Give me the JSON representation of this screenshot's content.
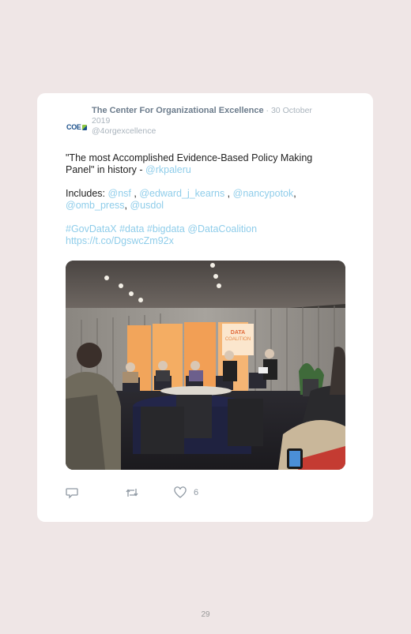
{
  "tweet": {
    "avatar_text": "COE",
    "author": "The Center For Organizational Excellence",
    "separator": " · ",
    "date": "30 October 2019",
    "handle": "@4orgexcellence",
    "text": {
      "line1_prefix": "\"The most Accomplished Evidence-Based Policy Making Panel\" in history - ",
      "mention_rkpaleru": "@rkpaleru",
      "includes_label": "Includes: ",
      "mention_nsf": "@nsf",
      "mention_edward": "@edward_j_kearns",
      "mention_nancy": "@nancypotok",
      "mention_omb": "@omb_press",
      "mention_usdol": "@usdol",
      "sep_space_comma": " , ",
      "sep_comma_space": ", ",
      "hashtag_govdatax": "#GovDataX",
      "hashtag_data": "#data",
      "hashtag_bigdata": "#bigdata",
      "mention_datacoalition": "@DataCoalition",
      "space": " ",
      "link": "https://t.co/DgswcZm92x"
    },
    "photo": {
      "banner_line1": "DATA",
      "banner_line2": "COALITION"
    },
    "actions": {
      "reply_icon": "reply-icon",
      "retweet_icon": "retweet-icon",
      "like_icon": "heart-icon",
      "like_count": "6"
    }
  },
  "page": {
    "number": "29"
  },
  "colors": {
    "background": "#efe6e6",
    "card": "#ffffff",
    "link": "#8fcdea",
    "muted": "#aab4bd",
    "author": "#6c7c8c"
  }
}
